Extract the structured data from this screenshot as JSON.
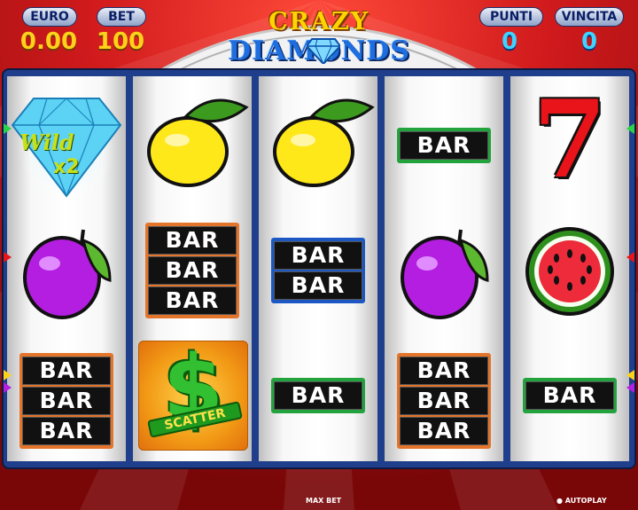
{
  "header": {
    "euro_label": "EURO",
    "euro_value": "0.00",
    "bet_label": "BET",
    "bet_value": "100",
    "punti_label": "PUNTI",
    "punti_value": "0",
    "vincita_label": "VINCITA",
    "vincita_value": "0"
  },
  "logo": {
    "line1": "CRAZY",
    "line2": "DIAMONDS"
  },
  "reels": [
    [
      "diamond-wild",
      "plum",
      "bar-3"
    ],
    [
      "lemon",
      "bar-3",
      "scatter"
    ],
    [
      "lemon",
      "bar-2",
      "bar-1"
    ],
    [
      "bar-1",
      "plum",
      "bar-3"
    ],
    [
      "seven",
      "watermelon",
      "bar-1"
    ]
  ],
  "symbols": {
    "bar_text": "BAR",
    "wild_text": "Wild",
    "wild_mult": "x2",
    "scatter_text": "SCATTER",
    "seven_text": "7"
  },
  "footer": {
    "max_bet": "MAX BET",
    "autoplay": "AUTOPLAY"
  },
  "colors": {
    "bg_red": "#c8151b",
    "frame_blue": "#1f3f8c",
    "value_yellow": "#ffd21a",
    "value_cyan": "#3fd4ff"
  }
}
